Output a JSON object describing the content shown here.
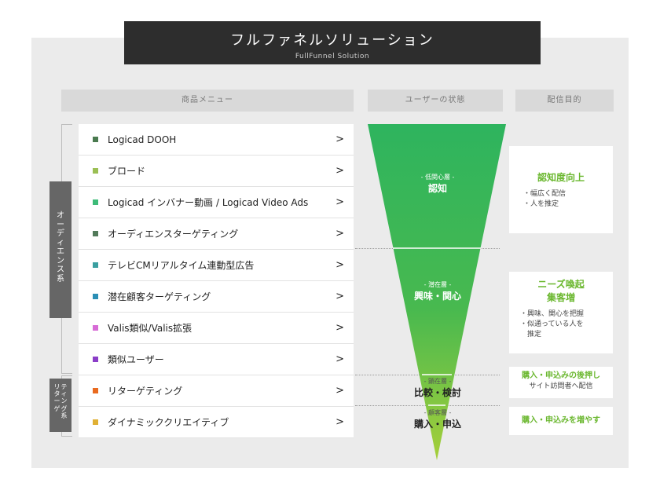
{
  "title": {
    "jp": "フルファネルソリューション",
    "en": "FullFunnel Solution"
  },
  "headers": {
    "menu": "商品メニュー",
    "state": "ユーザーの状態",
    "goal": "配信目的"
  },
  "groups": {
    "audience": "オーディエンス系",
    "retargeting": "リターゲティング系"
  },
  "menu_items": [
    {
      "label": "Logicad DOOH",
      "color": "#4a7a4f"
    },
    {
      "label": "ブロード",
      "color": "#9bbf54"
    },
    {
      "label": "Logicad インバナー動画 / Logicad Video Ads",
      "color": "#3dbb78"
    },
    {
      "label": "オーディエンスターゲティング",
      "color": "#527a5a"
    },
    {
      "label": "テレビCMリアルタイム連動型広告",
      "color": "#3a9fa0"
    },
    {
      "label": "潜在顧客ターゲティング",
      "color": "#2b8fb5"
    },
    {
      "label": "Valis類似/Valis拡張",
      "color": "#d76bd6"
    },
    {
      "label": "類似ユーザー",
      "color": "#8b3ec8"
    },
    {
      "label": "リターゲティング",
      "color": "#e96a1f"
    },
    {
      "label": "ダイナミッククリエイティブ",
      "color": "#e0b034"
    }
  ],
  "chevron": ">",
  "stages": [
    {
      "sub": "- 低関心層 -",
      "main": "認知"
    },
    {
      "sub": "- 潜在層 -",
      "main": "興味・関心"
    },
    {
      "sub": "- 顕在層 -",
      "main": "比較・検討"
    },
    {
      "sub": "- 顧客層 -",
      "main": "購入・申込"
    }
  ],
  "goals": [
    {
      "head": "認知度向上",
      "desc": [
        "・幅広く配信",
        "・人を推定"
      ]
    },
    {
      "head": [
        "ニーズ喚起",
        "集客増"
      ],
      "desc": [
        "・興味、関心を把握",
        "・似通っている人を",
        "　推定"
      ]
    },
    {
      "head": "購入・申込みの後押し",
      "desc": [
        "サイト訪問者へ配信"
      ]
    },
    {
      "head": "購入・申込みを増やす"
    }
  ],
  "colors": {
    "funnel_top": "#2eb45e",
    "funnel_bottom": "#a6cf3a",
    "accent": "#6ab72e",
    "title_bg": "#2d2d2d"
  }
}
